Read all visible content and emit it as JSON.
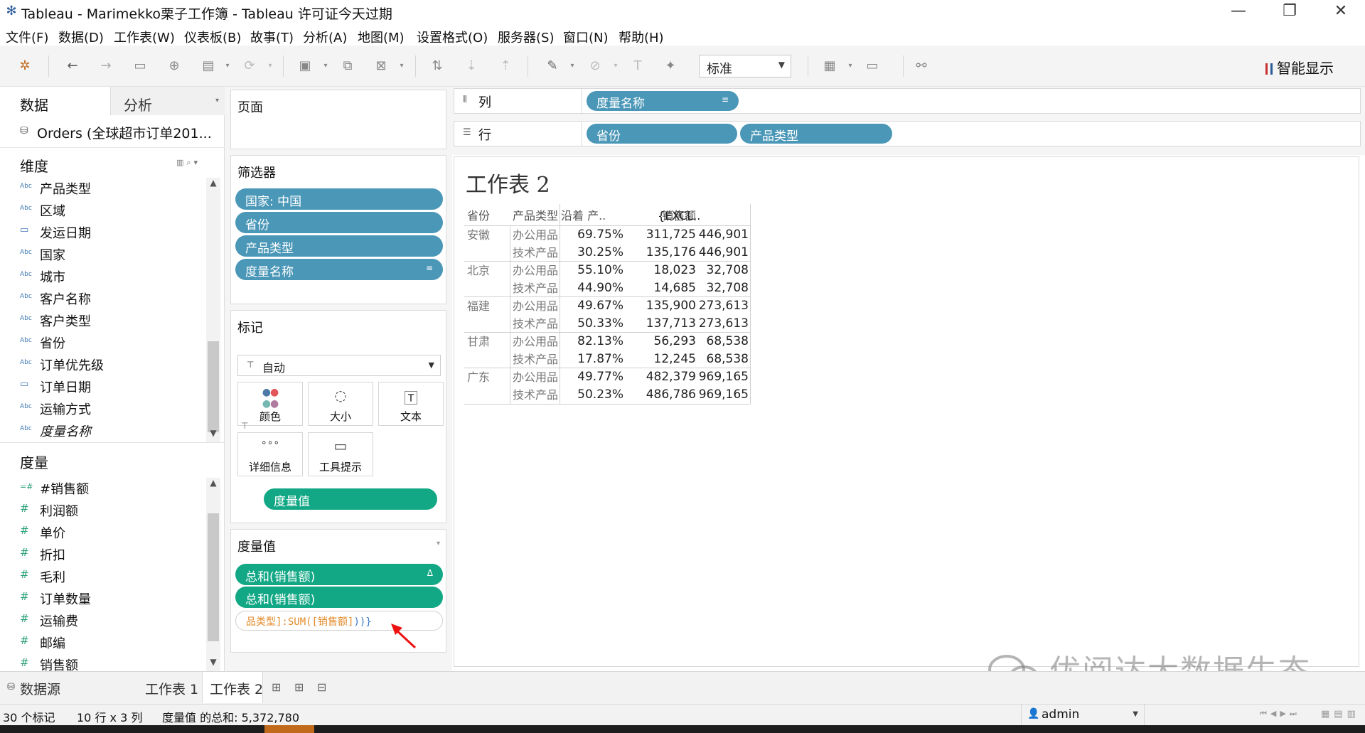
{
  "window": {
    "title": "Tableau - Marimekko栗子工作簿 - Tableau 许可证今天过期",
    "app_icon": "tableau-logo-icon"
  },
  "menu": [
    "文件(F)",
    "数据(D)",
    "工作表(W)",
    "仪表板(B)",
    "故事(T)",
    "分析(A)",
    "地图(M)",
    "设置格式(O)",
    "服务器(S)",
    "窗口(N)",
    "帮助(H)"
  ],
  "toolbar": {
    "fit_value": "标准",
    "show_me_label": "智能显示"
  },
  "data_pane": {
    "tab_data": "数据",
    "tab_analysis": "分析",
    "datasource": "Orders (全球超市订单201...",
    "dimensions_title": "维度",
    "dimensions": [
      {
        "name": "产品类型",
        "type": "Abc"
      },
      {
        "name": "区域",
        "type": "Abc"
      },
      {
        "name": "发运日期",
        "type": "date"
      },
      {
        "name": "国家",
        "type": "Abc"
      },
      {
        "name": "城市",
        "type": "Abc"
      },
      {
        "name": "客户名称",
        "type": "Abc"
      },
      {
        "name": "客户类型",
        "type": "Abc"
      },
      {
        "name": "省份",
        "type": "Abc"
      },
      {
        "name": "订单优先级",
        "type": "Abc"
      },
      {
        "name": "订单日期",
        "type": "date"
      },
      {
        "name": "运输方式",
        "type": "Abc"
      },
      {
        "name": "度量名称",
        "type": "Abc",
        "italic": true
      }
    ],
    "measures_title": "度量",
    "measures": [
      {
        "name": "#销售额",
        "type": "calc"
      },
      {
        "name": "利润额",
        "type": "#"
      },
      {
        "name": "单价",
        "type": "#"
      },
      {
        "name": "折扣",
        "type": "#"
      },
      {
        "name": "毛利",
        "type": "#"
      },
      {
        "name": "订单数量",
        "type": "#"
      },
      {
        "name": "运输费",
        "type": "#"
      },
      {
        "name": "邮编",
        "type": "#"
      },
      {
        "name": "销售额",
        "type": "#"
      }
    ]
  },
  "cards": {
    "pages_title": "页面",
    "filters_title": "筛选器",
    "filters": [
      "国家: 中国",
      "省份",
      "产品类型",
      "度量名称"
    ],
    "marks_title": "标记",
    "marks_type": "自动",
    "mark_buttons": [
      "颜色",
      "大小",
      "文本",
      "详细信息",
      "工具提示"
    ],
    "marks_pill": "度量值",
    "measure_values_title": "度量值",
    "measure_values": [
      "总和(销售额)",
      "总和(销售额)"
    ],
    "formula": {
      "part1": "品类型]:SUM(",
      "part2": "[销售额]",
      "part3": "))",
      "part4": "}"
    }
  },
  "shelves": {
    "columns_label": "列",
    "columns_pills": [
      "度量名称"
    ],
    "rows_label": "行",
    "rows_pills": [
      "省份",
      "产品类型"
    ]
  },
  "view": {
    "sheet_title": "工作表 2",
    "headers": [
      "省份",
      "产品类型",
      "沿着 产..",
      "销售额",
      "{EXCL.."
    ],
    "rows": [
      {
        "province": "安徽",
        "type": "办公用品",
        "pct": "69.75%",
        "sales": "311,725",
        "excl": "446,901"
      },
      {
        "province": "",
        "type": "技术产品",
        "pct": "30.25%",
        "sales": "135,176",
        "excl": "446,901"
      },
      {
        "province": "北京",
        "type": "办公用品",
        "pct": "55.10%",
        "sales": "18,023",
        "excl": "32,708"
      },
      {
        "province": "",
        "type": "技术产品",
        "pct": "44.90%",
        "sales": "14,685",
        "excl": "32,708"
      },
      {
        "province": "福建",
        "type": "办公用品",
        "pct": "49.67%",
        "sales": "135,900",
        "excl": "273,613"
      },
      {
        "province": "",
        "type": "技术产品",
        "pct": "50.33%",
        "sales": "137,713",
        "excl": "273,613"
      },
      {
        "province": "甘肃",
        "type": "办公用品",
        "pct": "82.13%",
        "sales": "56,293",
        "excl": "68,538"
      },
      {
        "province": "",
        "type": "技术产品",
        "pct": "17.87%",
        "sales": "12,245",
        "excl": "68,538"
      },
      {
        "province": "广东",
        "type": "办公用品",
        "pct": "49.77%",
        "sales": "482,379",
        "excl": "969,165"
      },
      {
        "province": "",
        "type": "技术产品",
        "pct": "50.23%",
        "sales": "486,786",
        "excl": "969,165"
      }
    ]
  },
  "tabs": {
    "datasource_tab": "数据源",
    "sheets": [
      "工作表 1",
      "工作表 2"
    ],
    "active_sheet": "工作表 2"
  },
  "status": {
    "marks": "30 个标记",
    "dims": "10 行 x 3 列",
    "sum": "度量值 的总和: 5,372,780",
    "user": "admin"
  },
  "watermark": "优阅达大数据生态",
  "colors": {
    "dimension_pill": "#4a97b7",
    "measure_pill": "#13a885",
    "formula_orange": "#e38a28",
    "formula_blue": "#3b78c4"
  }
}
